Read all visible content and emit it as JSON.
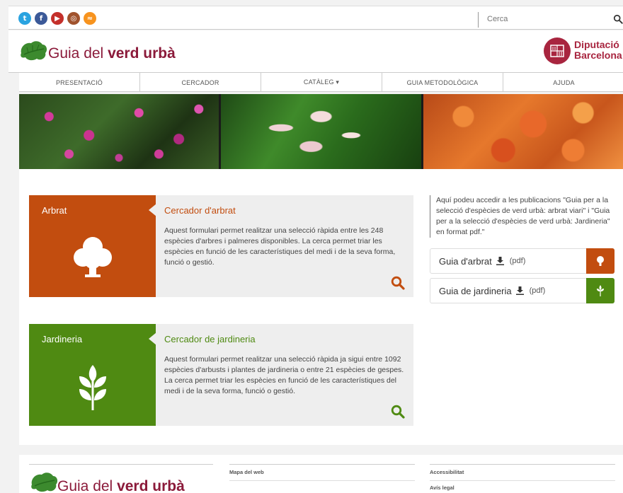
{
  "social": [
    {
      "name": "twitter",
      "glyph": "t",
      "color": "#2aa3e0"
    },
    {
      "name": "facebook",
      "glyph": "f",
      "color": "#3b5998"
    },
    {
      "name": "youtube",
      "glyph": "▶",
      "color": "#c4302b"
    },
    {
      "name": "instagram",
      "glyph": "◎",
      "color": "#a0522d"
    },
    {
      "name": "rss",
      "glyph": "≈",
      "color": "#f7931e"
    }
  ],
  "search": {
    "placeholder": "Cerca"
  },
  "header": {
    "brand_light": "Guia del ",
    "brand_bold": "verd urbà",
    "org_line1": "Diputació",
    "org_line2": "Barcelona"
  },
  "nav": [
    {
      "label": "Presentació",
      "name": "nav-presentacio"
    },
    {
      "label": "Cercador",
      "name": "nav-cercador"
    },
    {
      "label": "Catàleg ▾",
      "name": "nav-cataleg"
    },
    {
      "label": "Guia metodològica",
      "name": "nav-guia-metodologica"
    },
    {
      "label": "Ajuda",
      "name": "nav-ajuda"
    }
  ],
  "cards": {
    "arbrat": {
      "category": "Arbrat",
      "title": "Cercador d'arbrat",
      "desc": "Aquest formulari permet realitzar una selecció ràpida entre les 248 espècies d'arbres i palmeres disponibles. La cerca permet triar les espècies en funció de les característiques del medi i de la seva forma, funció o gestió."
    },
    "jardineria": {
      "category": "Jardineria",
      "title": "Cercador de jardineria",
      "desc": "Aquest formulari permet realitzar una selecció ràpida ja sigui entre 1092 espècies d'arbusts i plantes de jardineria o entre 21 espècies de gespes. La cerca permet triar les espècies en funció de les característiques del medi i de la seva forma, funció o gestió."
    }
  },
  "publications": {
    "text": "Aquí podeu accedir a les publicacions \"Guia per a la selecció d'espècies de verd urbà: arbrat viari\" i \"Guia per a la selecció d'espècies de verd urbà: Jardineria\" en format pdf.\"",
    "guide1": {
      "label": "Guia d'arbrat",
      "format": "(pdf)"
    },
    "guide2": {
      "label": "Guia de jardineria",
      "format": "(pdf)"
    }
  },
  "footer": {
    "brand_light": "Guia del ",
    "brand_bold": "verd urbà",
    "sitemap": "Mapa del web",
    "accessibility": "Accessibilitat",
    "legal": "Avís legal"
  },
  "colors": {
    "arbrat": "#c24d0f",
    "jardineria": "#4f8a12",
    "brand": "#8b1a3a",
    "diputacio": "#a8253f"
  }
}
